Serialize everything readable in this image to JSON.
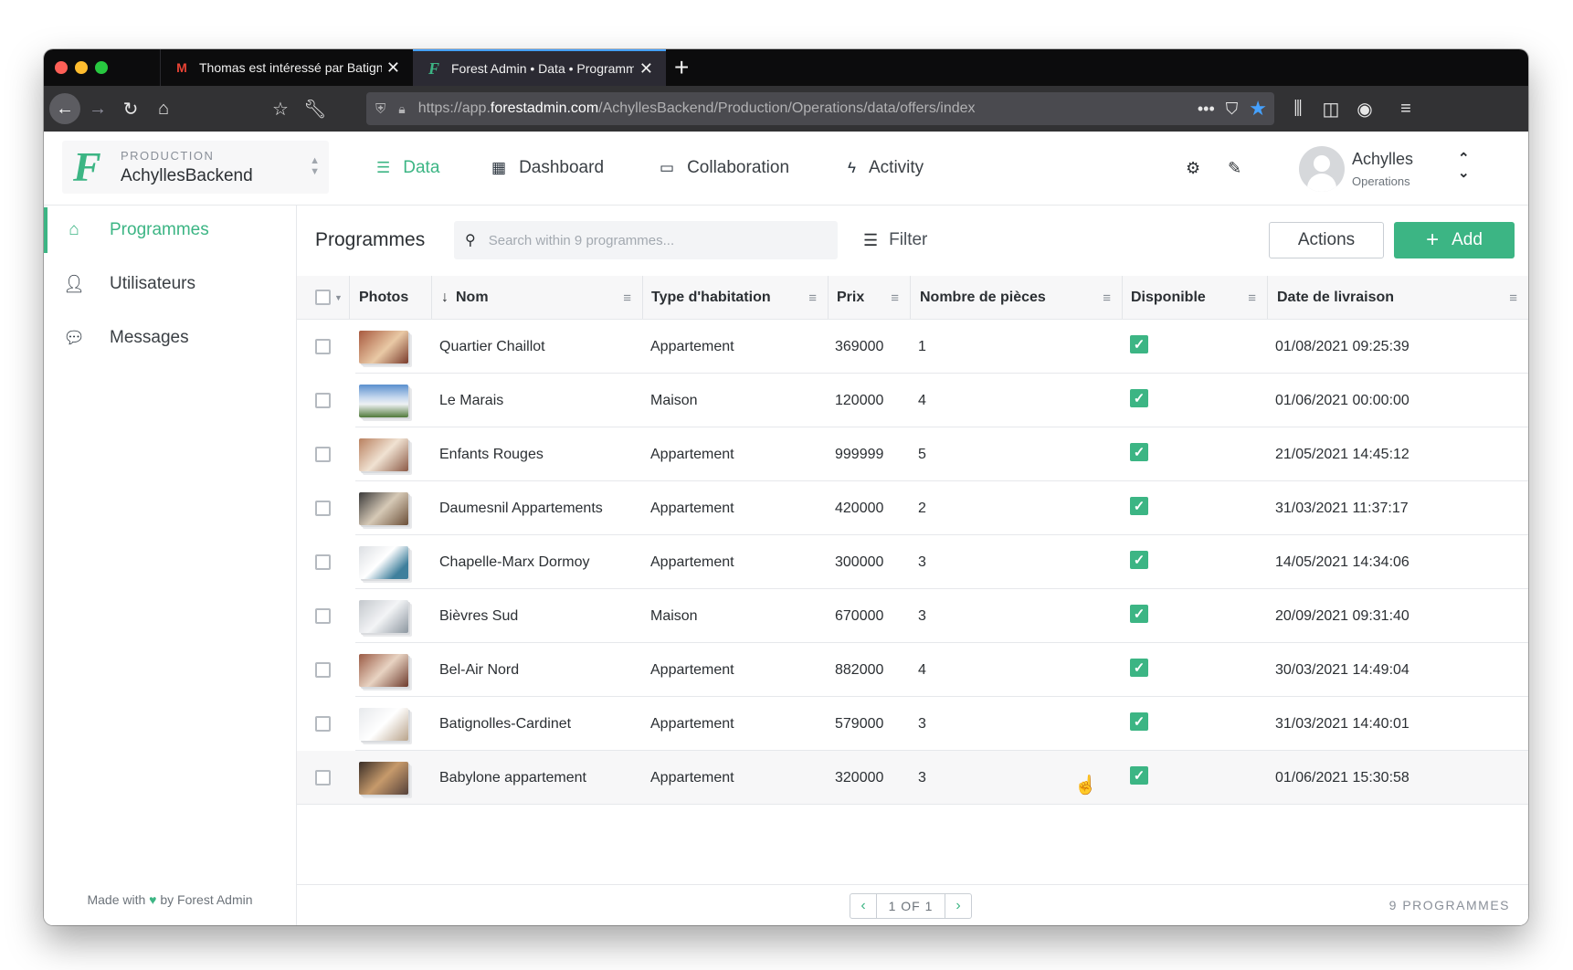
{
  "browser": {
    "tabs": [
      {
        "label": "Thomas est intéressé par Batignolles",
        "favicon": "gmail-icon"
      },
      {
        "label": "Forest Admin • Data • Programmes",
        "favicon": "forest-icon"
      }
    ],
    "url_prefix": "https://app.",
    "url_domain": "forestadmin.com",
    "url_path": "/AchyllesBackend/Production/Operations/data/offers/index"
  },
  "app": {
    "environment": "PRODUCTION",
    "project": "AchyllesBackend",
    "nav": [
      {
        "label": "Data",
        "icon": "list-icon"
      },
      {
        "label": "Dashboard",
        "icon": "dashboard-icon"
      },
      {
        "label": "Collaboration",
        "icon": "chat-icon"
      },
      {
        "label": "Activity",
        "icon": "bolt-icon"
      }
    ],
    "user": {
      "name": "Achylles",
      "role": "Operations"
    },
    "accent_color": "#3cb584"
  },
  "sidebar": {
    "items": [
      {
        "label": "Programmes",
        "icon": "home-icon"
      },
      {
        "label": "Utilisateurs",
        "icon": "user-icon"
      },
      {
        "label": "Messages",
        "icon": "message-icon"
      }
    ],
    "footer_before": "Made with",
    "footer_after": "by Forest Admin"
  },
  "toolbar": {
    "title": "Programmes",
    "search_placeholder": "Search within 9 programmes...",
    "filter_label": "Filter",
    "actions_label": "Actions",
    "add_label": "Add"
  },
  "table": {
    "columns": [
      "Photos",
      "Nom",
      "Type d'habitation",
      "Prix",
      "Nombre de pièces",
      "Disponible",
      "Date de livraison"
    ],
    "rows": [
      {
        "nom": "Quartier Chaillot",
        "type": "Appartement",
        "prix": "369000",
        "pieces": "1",
        "disponible": true,
        "date": "01/08/2021 09:25:39"
      },
      {
        "nom": "Le Marais",
        "type": "Maison",
        "prix": "120000",
        "pieces": "4",
        "disponible": true,
        "date": "01/06/2021 00:00:00"
      },
      {
        "nom": "Enfants Rouges",
        "type": "Appartement",
        "prix": "999999",
        "pieces": "5",
        "disponible": true,
        "date": "21/05/2021 14:45:12"
      },
      {
        "nom": "Daumesnil Appartements",
        "type": "Appartement",
        "prix": "420000",
        "pieces": "2",
        "disponible": true,
        "date": "31/03/2021 11:37:17"
      },
      {
        "nom": "Chapelle-Marx Dormoy",
        "type": "Appartement",
        "prix": "300000",
        "pieces": "3",
        "disponible": true,
        "date": "14/05/2021 14:34:06"
      },
      {
        "nom": "Bièvres Sud",
        "type": "Maison",
        "prix": "670000",
        "pieces": "3",
        "disponible": true,
        "date": "20/09/2021 09:31:40"
      },
      {
        "nom": "Bel-Air Nord",
        "type": "Appartement",
        "prix": "882000",
        "pieces": "4",
        "disponible": true,
        "date": "30/03/2021 14:49:04"
      },
      {
        "nom": "Batignolles-Cardinet",
        "type": "Appartement",
        "prix": "579000",
        "pieces": "3",
        "disponible": true,
        "date": "31/03/2021 14:40:01"
      },
      {
        "nom": "Babylone appartement",
        "type": "Appartement",
        "prix": "320000",
        "pieces": "3",
        "disponible": true,
        "date": "01/06/2021 15:30:58"
      }
    ]
  },
  "footer": {
    "page_info": "1 OF 1",
    "count": "9 PROGRAMMES"
  }
}
